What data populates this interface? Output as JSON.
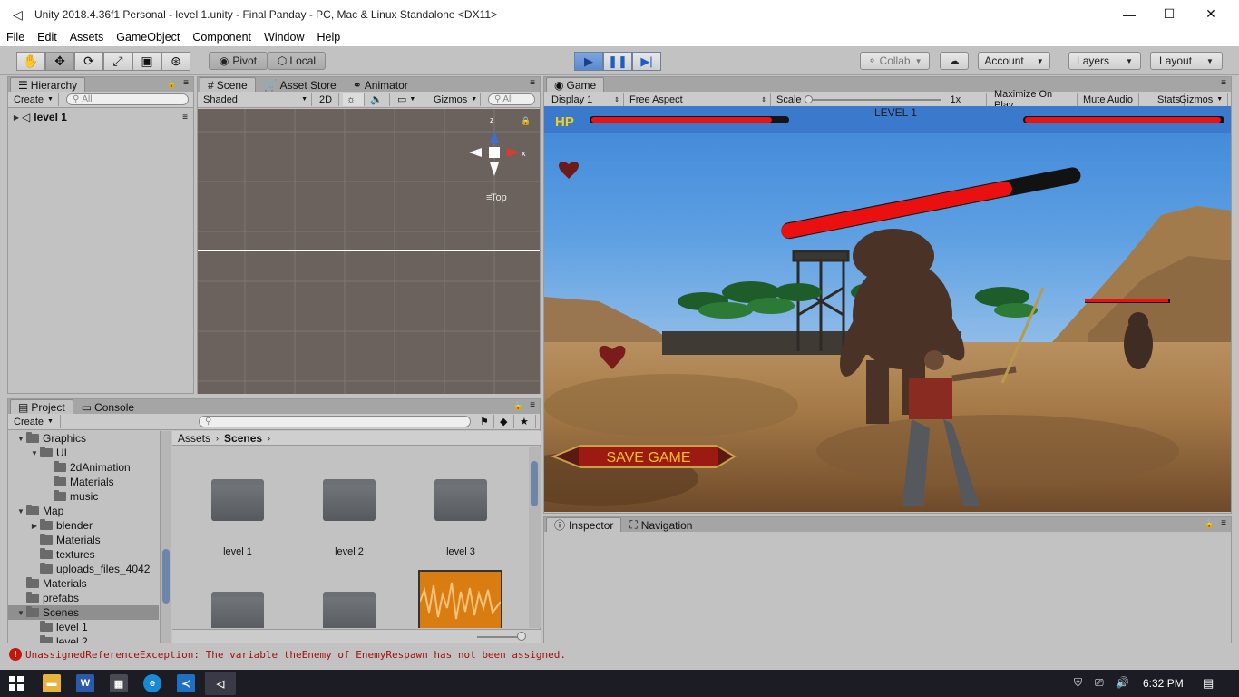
{
  "window": {
    "title": "Unity 2018.4.36f1 Personal - level 1.unity - Final Panday - PC, Mac & Linux Standalone <DX11>"
  },
  "menu": [
    "File",
    "Edit",
    "Assets",
    "GameObject",
    "Component",
    "Window",
    "Help"
  ],
  "toolbar": {
    "pivot": "Pivot",
    "local": "Local",
    "collab": "Collab",
    "account": "Account",
    "layers": "Layers",
    "layout": "Layout"
  },
  "hierarchy": {
    "tab": "Hierarchy",
    "create": "Create",
    "search_placeholder": "All",
    "root": "level 1"
  },
  "scene": {
    "tabs": [
      "Scene",
      "Asset Store",
      "Animator"
    ],
    "shaded": "Shaded",
    "mode2d": "2D",
    "gizmos": "Gizmos",
    "search_placeholder": "All",
    "view_label": "Top",
    "axis_y": "z",
    "axis_x": "x"
  },
  "game": {
    "tab": "Game",
    "display": "Display 1",
    "aspect": "Free Aspect",
    "scale_label": "Scale",
    "scale_value": "1x",
    "maximize": "Maximize On Play",
    "mute": "Mute Audio",
    "stats": "Stats",
    "gizmos": "Gizmos",
    "hud_hp": "HP",
    "hud_level": "LEVEL 1",
    "save_button": "SAVE GAME",
    "player_health": 0.92,
    "enemy_health": 0.99,
    "boss_health": 0.77,
    "small_enemy_health": 0.98
  },
  "project": {
    "tabs": [
      "Project",
      "Console"
    ],
    "create": "Create",
    "tree": [
      {
        "label": "Graphics",
        "depth": 1,
        "open": true
      },
      {
        "label": "UI",
        "depth": 2,
        "open": true
      },
      {
        "label": "2dAnimation",
        "depth": 3
      },
      {
        "label": "Materials",
        "depth": 3
      },
      {
        "label": "music",
        "depth": 3
      },
      {
        "label": "Map",
        "depth": 1,
        "open": true
      },
      {
        "label": "blender",
        "depth": 2,
        "closed": true
      },
      {
        "label": "Materials",
        "depth": 2
      },
      {
        "label": "textures",
        "depth": 2
      },
      {
        "label": "uploads_files_4042",
        "depth": 2
      },
      {
        "label": "Materials",
        "depth": 1
      },
      {
        "label": "prefabs",
        "depth": 1
      },
      {
        "label": "Scenes",
        "depth": 1,
        "open": true,
        "selected": true
      },
      {
        "label": "level 1",
        "depth": 2
      },
      {
        "label": "level 2",
        "depth": 2
      }
    ],
    "breadcrumb": [
      "Assets",
      "Scenes"
    ],
    "assets": [
      "level 1",
      "level 2",
      "level 3"
    ]
  },
  "inspector": {
    "tabs": [
      "Inspector",
      "Navigation"
    ]
  },
  "console_error": "UnassignedReferenceException: The variable theEnemy of EnemyRespawn has not been assigned.",
  "taskbar": {
    "time": "6:32 PM"
  }
}
